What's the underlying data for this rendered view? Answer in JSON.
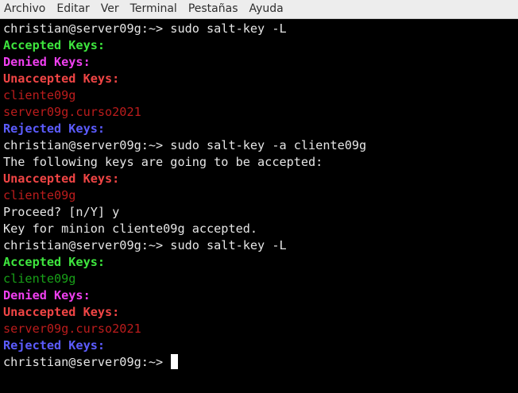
{
  "menubar": {
    "items": [
      "Archivo",
      "Editar",
      "Ver",
      "Terminal",
      "Pestañas",
      "Ayuda"
    ]
  },
  "terminal": {
    "lines": [
      {
        "text": "christian@server09g:~> sudo salt-key -L",
        "style": "normal"
      },
      {
        "text": "Accepted Keys:",
        "style": "accepted-head"
      },
      {
        "text": "Denied Keys:",
        "style": "denied-head"
      },
      {
        "text": "Unaccepted Keys:",
        "style": "unaccepted-head"
      },
      {
        "text": "cliente09g",
        "style": "key-unaccepted"
      },
      {
        "text": "server09g.curso2021",
        "style": "key-unaccepted"
      },
      {
        "text": "Rejected Keys:",
        "style": "rejected-head"
      },
      {
        "text": "christian@server09g:~> sudo salt-key -a cliente09g",
        "style": "normal"
      },
      {
        "text": "The following keys are going to be accepted:",
        "style": "normal"
      },
      {
        "text": "Unaccepted Keys:",
        "style": "unaccepted-head"
      },
      {
        "text": "cliente09g",
        "style": "key-unaccepted"
      },
      {
        "text": "Proceed? [n/Y] y",
        "style": "normal"
      },
      {
        "text": "Key for minion cliente09g accepted.",
        "style": "normal"
      },
      {
        "text": "christian@server09g:~> sudo salt-key -L",
        "style": "normal"
      },
      {
        "text": "Accepted Keys:",
        "style": "accepted-head"
      },
      {
        "text": "cliente09g",
        "style": "key-accepted"
      },
      {
        "text": "Denied Keys:",
        "style": "denied-head"
      },
      {
        "text": "Unaccepted Keys:",
        "style": "unaccepted-head"
      },
      {
        "text": "server09g.curso2021",
        "style": "key-unaccepted"
      },
      {
        "text": "Rejected Keys:",
        "style": "rejected-head"
      }
    ],
    "prompt": "christian@server09g:~> "
  },
  "colors": {
    "background": "#000000",
    "text": "#e6e6e6",
    "accepted": "#3ee63e",
    "denied": "#f03ff0",
    "unaccepted": "#f04545",
    "rejected": "#5c5cff",
    "key_unaccepted": "#bb1c1c",
    "key_accepted": "#18a018"
  }
}
